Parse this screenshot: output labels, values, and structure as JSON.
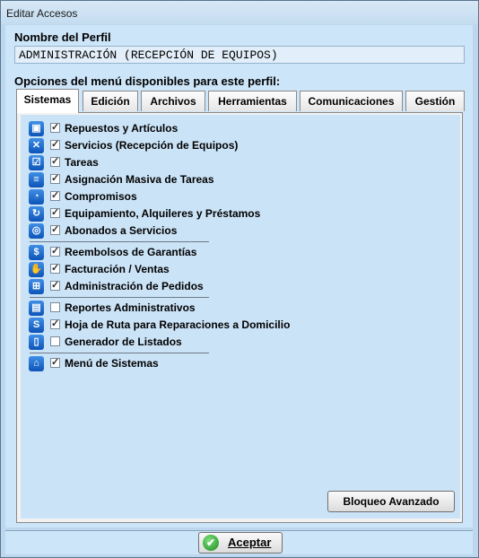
{
  "window": {
    "title": "Editar Accesos"
  },
  "perfil": {
    "label": "Nombre del Perfil",
    "value": "ADMINISTRACIÓN (RECEPCIÓN DE EQUIPOS)"
  },
  "opciones_label": "Opciones del menú disponibles para este perfil:",
  "tabs": [
    {
      "label": "Sistemas",
      "active": true
    },
    {
      "label": "Edición",
      "active": false
    },
    {
      "label": "Archivos",
      "active": false
    },
    {
      "label": "Herramientas",
      "active": false
    },
    {
      "label": "Comunicaciones",
      "active": false
    },
    {
      "label": "Gestión",
      "active": false
    }
  ],
  "items": [
    {
      "label": "Repuestos y Artículos",
      "checked": true,
      "icon": "box-icon"
    },
    {
      "label": "Servicios (Recepción de Equipos)",
      "checked": true,
      "icon": "tools-icon"
    },
    {
      "label": "Tareas",
      "checked": true,
      "icon": "task-icon"
    },
    {
      "label": "Asignación Masiva de Tareas",
      "checked": true,
      "icon": "list-assign-icon"
    },
    {
      "label": "Compromisos",
      "checked": true,
      "icon": "clock-icon"
    },
    {
      "label": "Equipamiento, Alquileres y Préstamos",
      "checked": true,
      "icon": "cycle-icon"
    },
    {
      "label": "Abonados a Servicios",
      "checked": true,
      "icon": "subscriber-icon"
    },
    {
      "label": "Reembolsos de Garantías",
      "checked": true,
      "icon": "refund-icon"
    },
    {
      "label": "Facturación / Ventas",
      "checked": true,
      "icon": "hand-money-icon"
    },
    {
      "label": "Administración de Pedidos",
      "checked": true,
      "icon": "cart-icon"
    },
    {
      "label": "Reportes Administrativos",
      "checked": false,
      "icon": "reports-icon"
    },
    {
      "label": "Hoja de Ruta para Reparaciones a Domicilio",
      "checked": true,
      "icon": "route-icon"
    },
    {
      "label": "Generador de Listados",
      "checked": false,
      "icon": "document-icon"
    },
    {
      "label": "Menú de Sistemas",
      "checked": true,
      "icon": "home-icon"
    }
  ],
  "buttons": {
    "bloqueo": "Bloqueo Avanzado",
    "aceptar": "Aceptar"
  }
}
